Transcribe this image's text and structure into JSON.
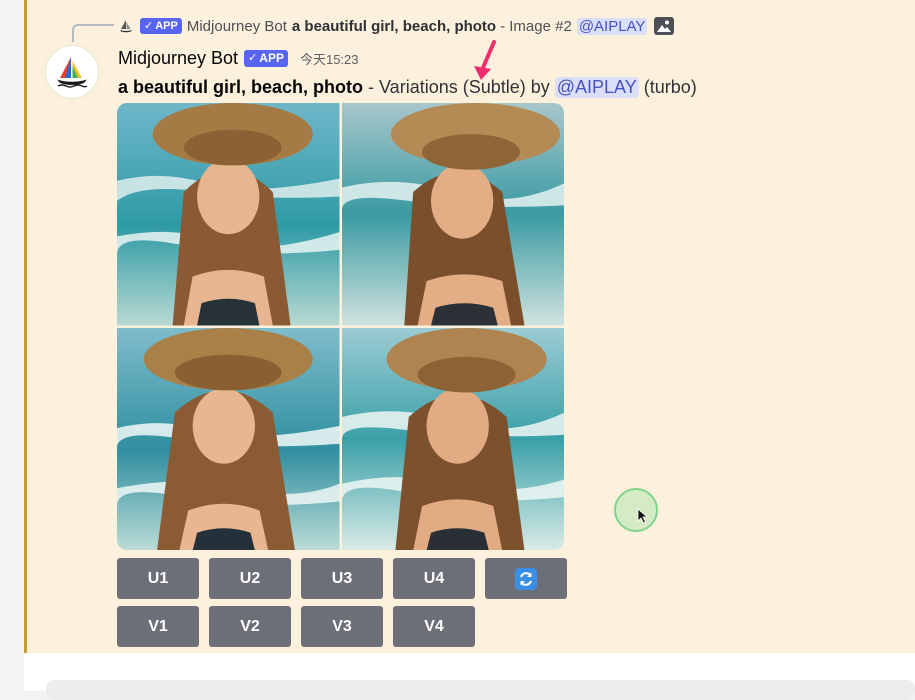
{
  "reply": {
    "app_badge": "APP",
    "bot_name": "Midjourney Bot",
    "prompt": "a beautiful girl, beach, photo",
    "rest": "- Image #2",
    "mention": "@AIPLAY"
  },
  "message": {
    "username": "Midjourney Bot",
    "app_badge": "APP",
    "timestamp": "今天15:23",
    "prompt": "a beautiful girl, beach, photo",
    "separator": "-",
    "action_text": "Variations (Subtle) by",
    "mention": "@AIPLAY",
    "mode": "(turbo)"
  },
  "image_grid": {
    "tiles": [
      "girl-1",
      "girl-2",
      "girl-3",
      "girl-4"
    ]
  },
  "buttons": {
    "row1": [
      "U1",
      "U2",
      "U3",
      "U4"
    ],
    "row2": [
      "V1",
      "V2",
      "V3",
      "V4"
    ],
    "reroll_icon": "refresh-icon"
  },
  "colors": {
    "message_bg": "#fbf1dc",
    "accent_border": "#c69a2c",
    "button_bg": "#6d6f78",
    "badge": "#5865f2",
    "mention_bg": "#dbdff9",
    "mention_text": "#4752c4",
    "annotation_arrow": "#ee2d6d"
  }
}
